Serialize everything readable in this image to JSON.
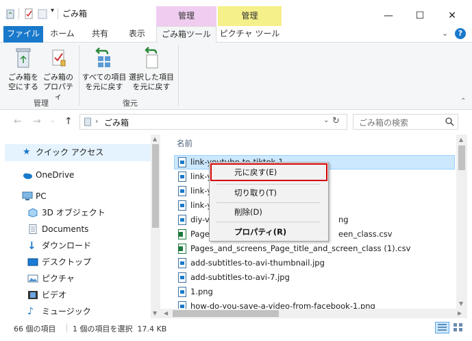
{
  "window": {
    "title": "ごみ箱",
    "context_group_1": "管理",
    "context_group_2": "管理",
    "controls": {
      "minimize": "—",
      "maximize": "☐",
      "close": "✕"
    }
  },
  "ribbon_tabs": [
    {
      "label": "ファイル"
    },
    {
      "label": "ホーム"
    },
    {
      "label": "共有"
    },
    {
      "label": "表示"
    },
    {
      "label": "ごみ箱ツール"
    },
    {
      "label": "ピクチャ ツール"
    }
  ],
  "ribbon": {
    "empty_bin": "ごみ箱を\n空にする",
    "bin_properties": "ごみ箱の\nプロパティ",
    "group_manage": "管理",
    "restore_all": "すべての項目\nを元に戻す",
    "restore_selected": "選択した項目\nを元に戻す",
    "group_restore": "復元"
  },
  "address": {
    "path": "ごみ箱",
    "search_placeholder": "ごみ箱の検索"
  },
  "nav_pane": [
    {
      "label": "クイック アクセス"
    },
    {
      "label": "OneDrive"
    },
    {
      "label": "PC"
    },
    {
      "label": "3D オブジェクト"
    },
    {
      "label": "Documents"
    },
    {
      "label": "ダウンロード"
    },
    {
      "label": "デスクトップ"
    },
    {
      "label": "ピクチャ"
    },
    {
      "label": "ビデオ"
    },
    {
      "label": "ミュージック"
    }
  ],
  "file_list": {
    "column_name": "名前",
    "files": [
      {
        "name": "link-youtube-to-tiktok-1"
      },
      {
        "name": "link-y"
      },
      {
        "name": "link-y"
      },
      {
        "name": "link-y"
      },
      {
        "name": "diy-vs"
      },
      {
        "name": "Pages_"
      },
      {
        "name": "Pages_and_screens_Page_title_and_screen_class (1).csv"
      },
      {
        "name": "add-subtitles-to-avi-thumbnail.jpg"
      },
      {
        "name": "add-subtitles-to-avi-7.jpg"
      },
      {
        "name": "1.png"
      },
      {
        "name": "how-do-you-save-a-video-from-facebook-1.png"
      }
    ],
    "partial_suffixes": {
      "row4": "ng",
      "row5": "een_class.csv"
    }
  },
  "context_menu": {
    "restore": "元に戻す(E)",
    "cut": "切り取り(T)",
    "delete": "削除(D)",
    "properties": "プロパティ(R)"
  },
  "status": {
    "item_count": "66 個の項目",
    "selection": "1 個の項目を選択  17.4 KB"
  },
  "colors": {
    "accent": "#1979ca",
    "context_tab_pink": "#f0cdf0",
    "context_tab_yellow": "#f5f089",
    "selected_row": "#cce8ff",
    "highlight_border": "#d40000"
  }
}
